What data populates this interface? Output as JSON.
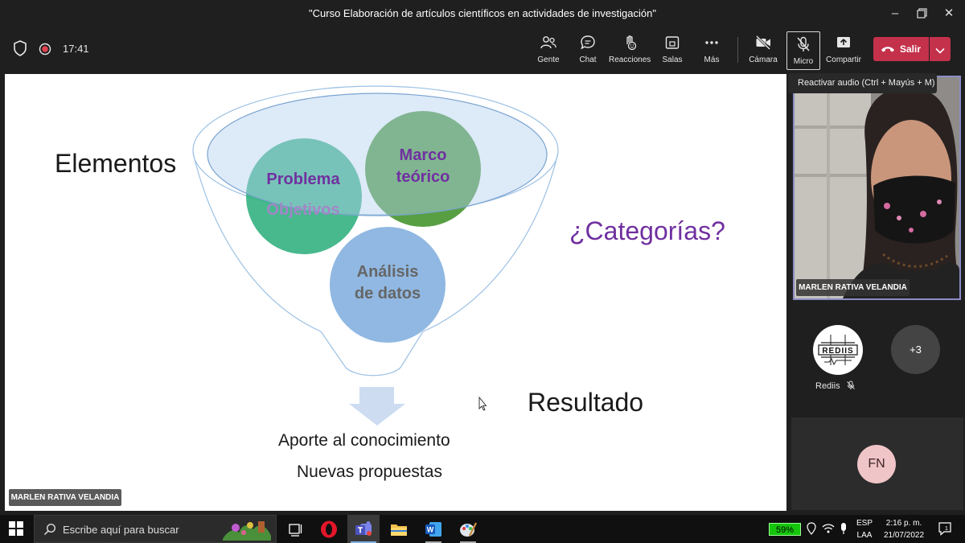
{
  "window": {
    "title": "\"Curso Elaboración de artículos científicos en actividades de investigación\""
  },
  "toolbar": {
    "timer": "17:41",
    "people_label": "Gente",
    "chat_label": "Chat",
    "reactions_label": "Reacciones",
    "rooms_label": "Salas",
    "more_label": "Más",
    "camera_label": "Cámara",
    "mic_label": "Micro",
    "share_label": "Compartir",
    "leave_label": "Salir"
  },
  "tooltip": {
    "text": "Reactivar audio (Ctrl + Mayús + M)"
  },
  "slide": {
    "elements_label": "Elementos",
    "circle_problem_line1": "Problema",
    "circle_problem_line2": "Objetivos",
    "circle_framework_line1": "Marco",
    "circle_framework_line2": "teórico",
    "circle_analysis_line1": "Análisis",
    "circle_analysis_line2": "de datos",
    "categories_label": "¿Categorías?",
    "result_label": "Resultado",
    "outcome_line1": "Aporte al conocimiento",
    "outcome_line2": "Nuevas propuestas",
    "presenter_tag": "MARLEN RATIVA VELANDIA"
  },
  "participants": {
    "video_name": "MARLEN RATIVA VELANDIA",
    "rediis_name": "Rediis",
    "rediis_logo_text": "REDIIS",
    "overflow_count": "+3",
    "fn_initials": "FN"
  },
  "taskbar": {
    "search_placeholder": "Escribe aquí para buscar",
    "battery": "59%",
    "lang_line1": "ESP",
    "lang_line2": "LAA",
    "time": "2:16 p. m.",
    "date": "21/07/2022"
  },
  "colors": {
    "leave_red": "#c4314b",
    "circle_green": "#2eaf7d",
    "circle_olive": "#4f9a3a",
    "circle_blue": "#8ab4e0",
    "purple_text": "#7030a0",
    "active_border": "#8b8cc7"
  }
}
